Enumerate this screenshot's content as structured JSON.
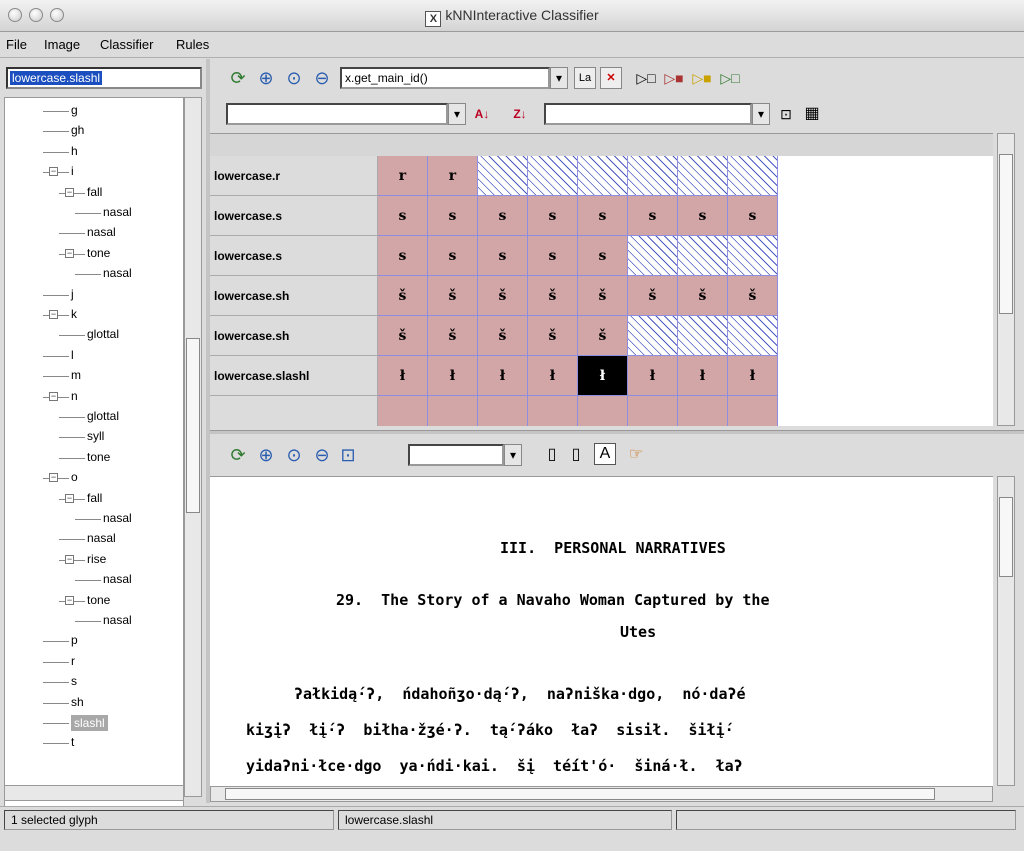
{
  "window": {
    "title": "kNNInteractive Classifier",
    "x_icon": "X"
  },
  "menu": [
    "File",
    "Image",
    "Classifier",
    "Rules"
  ],
  "left": {
    "search_value": "lowercase.slashl",
    "tree": [
      {
        "label": "g"
      },
      {
        "label": "gh"
      },
      {
        "label": "h"
      },
      {
        "label": "i"
      },
      {
        "label": "fall"
      },
      {
        "label": "nasal"
      },
      {
        "label": "nasal"
      },
      {
        "label": "tone"
      },
      {
        "label": "nasal"
      },
      {
        "label": "j"
      },
      {
        "label": "k"
      },
      {
        "label": "glottal"
      },
      {
        "label": "l"
      },
      {
        "label": "m"
      },
      {
        "label": "n"
      },
      {
        "label": "glottal"
      },
      {
        "label": "syll"
      },
      {
        "label": "tone"
      },
      {
        "label": "o"
      },
      {
        "label": "fall"
      },
      {
        "label": "nasal"
      },
      {
        "label": "nasal"
      },
      {
        "label": "rise"
      },
      {
        "label": "nasal"
      },
      {
        "label": "tone"
      },
      {
        "label": "nasal"
      },
      {
        "label": "p"
      },
      {
        "label": "r"
      },
      {
        "label": "s"
      },
      {
        "label": "sh"
      },
      {
        "label": "slashl"
      },
      {
        "label": "t"
      }
    ]
  },
  "top_toolbar": {
    "id_combo": "x.get_main_id()",
    "la_button": "La",
    "filter_combo": "",
    "second_combo": ""
  },
  "grid": {
    "rows": [
      {
        "label": "lowercase.r",
        "glyphs": [
          "r",
          "r",
          "",
          "",
          "",
          "",
          "",
          ""
        ],
        "hatched_from": 2
      },
      {
        "label": "lowercase.s",
        "glyphs": [
          "s",
          "s",
          "s",
          "s",
          "s",
          "s",
          "s",
          "s"
        ],
        "hatched_from": 8
      },
      {
        "label": "lowercase.s",
        "glyphs": [
          "s",
          "s",
          "s",
          "s",
          "s",
          "",
          "",
          ""
        ],
        "hatched_from": 5
      },
      {
        "label": "lowercase.sh",
        "glyphs": [
          "š",
          "š",
          "š",
          "š",
          "š",
          "š",
          "š",
          "š"
        ],
        "hatched_from": 8
      },
      {
        "label": "lowercase.sh",
        "glyphs": [
          "š",
          "š",
          "š",
          "š",
          "š",
          "",
          "",
          ""
        ],
        "hatched_from": 5
      },
      {
        "label": "lowercase.slashl",
        "glyphs": [
          "ł",
          "ł",
          "ł",
          "ł",
          "ł",
          "ł",
          "ł",
          "ł"
        ],
        "hatched_from": 8,
        "selected_col": 4
      }
    ]
  },
  "document": {
    "lines": [
      "III.  PERSONAL NARRATIVES",
      "29.  The Story of a Navaho Woman Captured by the",
      "Utes",
      "ʔałkidą́·ʔ,  ńdahoñʒo·dą́·ʔ,  naʔniška·dgo,  nó·daʔé",
      "kiʒįʔ  łį́·ʔ  biłha·žʒé·ʔ.  tą́·ʔáko  łaʔ  sisił.  šiłį́·",
      "yidaʔni·łce·dgo  ya·ńdi·kai.  šį  té́ít'ó·  šiná·ł.  łaʔ"
    ]
  },
  "status": {
    "selected": "1 selected glyph",
    "class_name": "lowercase.slashl",
    "extra": ""
  }
}
